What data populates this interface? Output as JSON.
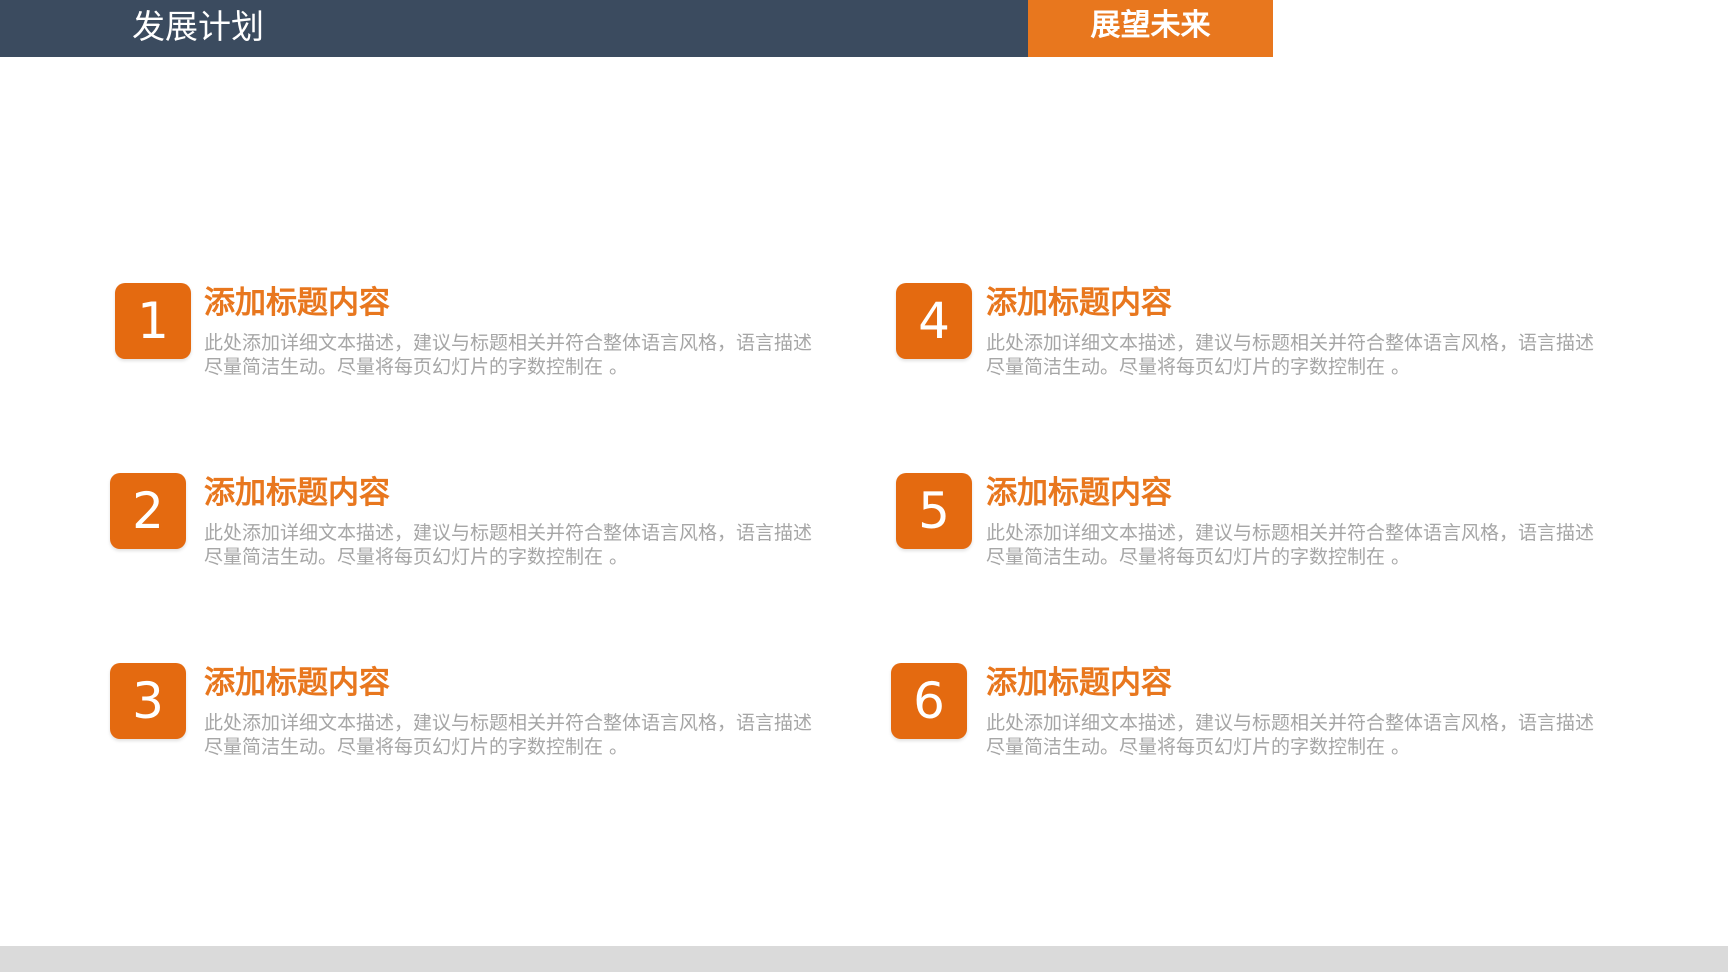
{
  "header": {
    "title": "发展计划",
    "tab_label": "展望未来"
  },
  "colors": {
    "header_bg": "#3b4b5f",
    "accent": "#e8771e",
    "badge": "#e46a10",
    "desc_text": "#a6a6a6",
    "footer": "#dadada"
  },
  "items": [
    {
      "number": "1",
      "title": "添加标题内容",
      "description": "此处添加详细文本描述，建议与标题相关并符合整体语言风格，语言描述尽量简洁生动。尽量将每页幻灯片的字数控制在 。"
    },
    {
      "number": "2",
      "title": "添加标题内容",
      "description": "此处添加详细文本描述，建议与标题相关并符合整体语言风格，语言描述尽量简洁生动。尽量将每页幻灯片的字数控制在 。"
    },
    {
      "number": "3",
      "title": "添加标题内容",
      "description": "此处添加详细文本描述，建议与标题相关并符合整体语言风格，语言描述尽量简洁生动。尽量将每页幻灯片的字数控制在 。"
    },
    {
      "number": "4",
      "title": "添加标题内容",
      "description": "此处添加详细文本描述，建议与标题相关并符合整体语言风格，语言描述尽量简洁生动。尽量将每页幻灯片的字数控制在 。"
    },
    {
      "number": "5",
      "title": "添加标题内容",
      "description": "此处添加详细文本描述，建议与标题相关并符合整体语言风格，语言描述尽量简洁生动。尽量将每页幻灯片的字数控制在 。"
    },
    {
      "number": "6",
      "title": "添加标题内容",
      "description": "此处添加详细文本描述，建议与标题相关并符合整体语言风格，语言描述尽量简洁生动。尽量将每页幻灯片的字数控制在 。"
    }
  ]
}
